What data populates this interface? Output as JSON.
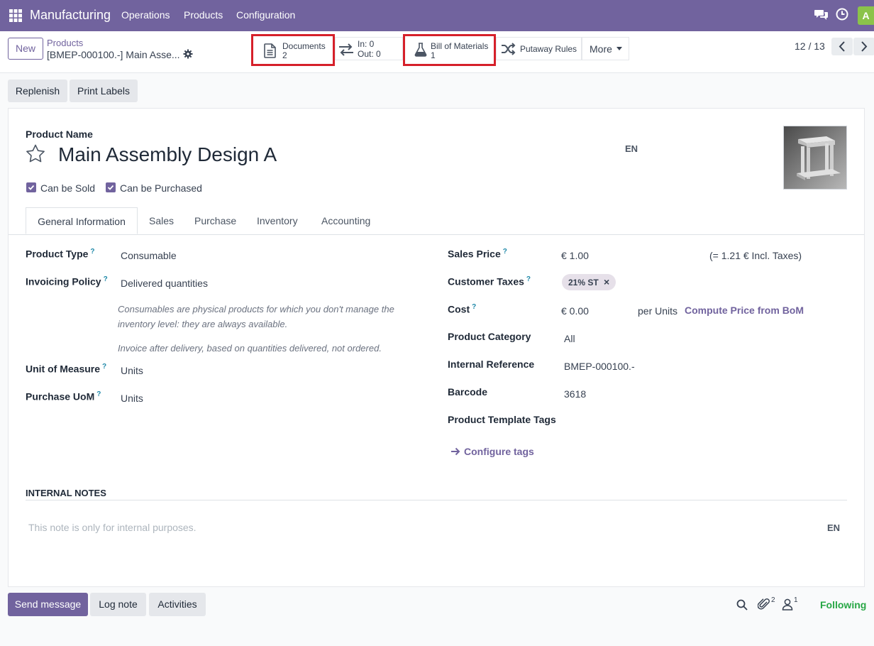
{
  "navbar": {
    "app_name": "Manufacturing",
    "menu": [
      "Operations",
      "Products",
      "Configuration"
    ],
    "avatar_letter": "A",
    "colors": {
      "bar": "#71639e",
      "avatar": "#8bc34a"
    }
  },
  "control_panel": {
    "new_label": "New",
    "breadcrumb_parent": "Products",
    "breadcrumb_current": "[BMEP-000100.-] Main Asse...",
    "smart_buttons": {
      "documents": {
        "label": "Documents",
        "value": "2"
      },
      "moves": {
        "in_label": "In: 0",
        "out_label": "Out: 0"
      },
      "bom": {
        "label": "Bill of Materials",
        "value": "1"
      },
      "putaway": {
        "label": "Putaway Rules"
      },
      "more": {
        "label": "More"
      }
    },
    "pager": "12 / 13"
  },
  "actions": {
    "replenish": "Replenish",
    "print_labels": "Print Labels"
  },
  "form": {
    "product_name_label": "Product Name",
    "product_name": "Main Assembly Design A",
    "lang": "EN",
    "can_be_sold": "Can be Sold",
    "can_be_purchased": "Can be Purchased",
    "tabs": [
      "General Information",
      "Sales",
      "Purchase",
      "Inventory",
      "Accounting"
    ],
    "left": {
      "product_type_label": "Product Type",
      "product_type": "Consumable",
      "invoicing_policy_label": "Invoicing Policy",
      "invoicing_policy": "Delivered quantities",
      "help_consumable_1": "Consumables are physical products for which you don't manage the",
      "help_consumable_2": "inventory level: they are always available.",
      "help_invoice": "Invoice after delivery, based on quantities delivered, not ordered.",
      "uom_label": "Unit of Measure",
      "uom": "Units",
      "purchase_uom_label": "Purchase UoM",
      "purchase_uom": "Units"
    },
    "right": {
      "sales_price_label": "Sales Price",
      "sales_price": "€ 1.00",
      "incl_taxes": "(= 1.21 € Incl. Taxes)",
      "customer_taxes_label": "Customer Taxes",
      "customer_tax": "21% ST",
      "cost_label": "Cost",
      "cost": "€ 0.00",
      "per_units": "per Units",
      "compute_bom": "Compute Price from BoM",
      "category_label": "Product Category",
      "category": "All",
      "internal_ref_label": "Internal Reference",
      "internal_ref": "BMEP-000100.-",
      "barcode_label": "Barcode",
      "barcode": "3618",
      "tags_label": "Product Template Tags",
      "configure_tags": "Configure tags"
    },
    "notes_title": "INTERNAL NOTES",
    "notes_placeholder": "This note is only for internal purposes.",
    "notes_lang": "EN"
  },
  "chatter": {
    "send_message": "Send message",
    "log_note": "Log note",
    "activities": "Activities",
    "attachments_count": "2",
    "followers_count": "1",
    "following": "Following"
  }
}
